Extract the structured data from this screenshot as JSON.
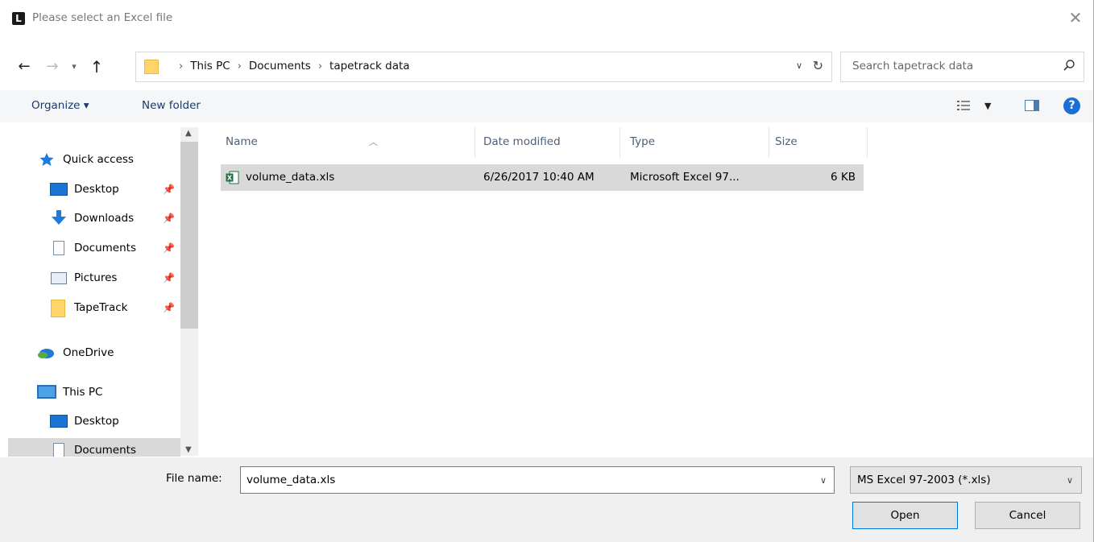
{
  "window": {
    "title": "Please select an Excel file",
    "app_icon_letter": "L",
    "close_glyph": "✕"
  },
  "address": {
    "crumbs": [
      "This PC",
      "Documents",
      "tapetrack data"
    ],
    "search_placeholder": "Search tapetrack data"
  },
  "toolbar": {
    "organize_label": "Organize ▾",
    "new_folder_label": "New folder",
    "help_glyph": "?"
  },
  "nav": {
    "items": [
      {
        "label": "Quick access",
        "icon": "star-icon",
        "pinned": false
      },
      {
        "label": "Desktop",
        "icon": "desktop-icon",
        "pinned": true
      },
      {
        "label": "Downloads",
        "icon": "download-icon",
        "pinned": true
      },
      {
        "label": "Documents",
        "icon": "documents-icon",
        "pinned": true
      },
      {
        "label": "Pictures",
        "icon": "pictures-icon",
        "pinned": true
      },
      {
        "label": "TapeTrack",
        "icon": "folder-icon",
        "pinned": true
      },
      {
        "label": "OneDrive",
        "icon": "onedrive-icon",
        "pinned": false
      },
      {
        "label": "This PC",
        "icon": "computer-icon",
        "pinned": false
      },
      {
        "label": "Desktop",
        "icon": "desktop-icon",
        "pinned": false
      },
      {
        "label": "Documents",
        "icon": "documents-icon",
        "pinned": false,
        "selected": true
      }
    ]
  },
  "file_list": {
    "columns": [
      "Name",
      "Date modified",
      "Type",
      "Size"
    ],
    "rows": [
      {
        "name": "volume_data.xls",
        "date": "6/26/2017 10:40 AM",
        "type": "Microsoft Excel 97...",
        "size": "6 KB",
        "icon": "excel-file-icon",
        "selected": true
      }
    ]
  },
  "footer": {
    "file_name_label": "File name:",
    "file_name_value": "volume_data.xls",
    "filter_value": "MS Excel 97-2003 (*.xls)",
    "open_label": "Open",
    "cancel_label": "Cancel"
  },
  "colors": {
    "accent": "#0078d7",
    "selection": "#d9d9d9",
    "folder": "#ffd56b"
  }
}
